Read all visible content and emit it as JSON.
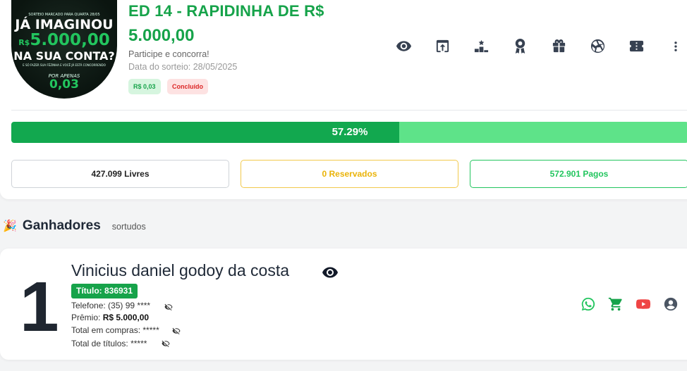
{
  "campaign": {
    "image_text": {
      "top": "SORTEIO MARCADO PARA QUARTA 28/05",
      "line1": "JÁ IMAGINOU",
      "line2_prefix": "R$",
      "line2": "5.000,00",
      "line3": "NA SUA CONTA?",
      "small": "E SÓ FAZER SUA FÉZINHA E VOCÊ JÁ ESTÁ CONCORRENDO",
      "por_apenas": "POR APENAS",
      "price": "0,03"
    },
    "title": "ED 14 - RAPIDINHA DE R$",
    "prize": "5.000,00",
    "subtitle": "Participe e concorra!",
    "draw_date": "Data do sorteio: 28/05/2025",
    "price_badge": "R$ 0,03",
    "status_badge": "Concluído"
  },
  "toolbar_icons": [
    "eye-icon",
    "share-upload-icon",
    "podium-icon",
    "award-ribbon-icon",
    "gift-icon",
    "wheel-icon",
    "ticket-icon",
    "more-vertical-icon"
  ],
  "progress": {
    "percent": 57.29,
    "label": "57.29%"
  },
  "stats": {
    "free": "427.099 Livres",
    "reserved": "0 Reservados",
    "paid": "572.901 Pagos"
  },
  "winners": {
    "emoji": "🎉",
    "heading": "Ganhadores",
    "subheading": "sortudos",
    "items": [
      {
        "rank": "1",
        "name": "Vinicius daniel godoy da costa",
        "ticket": "Título: 836931",
        "phone_label": "Telefone:",
        "phone": "(35) 99 ****",
        "prize_label": "Prêmio:",
        "prize": "R$ 5.000,00",
        "purchases_label": "Total em compras:",
        "purchases": "*****",
        "titles_label": "Total de títulos:",
        "titles": "*****"
      }
    ]
  },
  "colors": {
    "brand_green": "#16a34a",
    "progress_track": "#5ee389",
    "reserved_yellow": "#eab308",
    "danger_red": "#dc2626",
    "whatsapp": "#22c55e",
    "cart": "#16a34a",
    "youtube": "#ef4444",
    "user": "#4b5563"
  }
}
